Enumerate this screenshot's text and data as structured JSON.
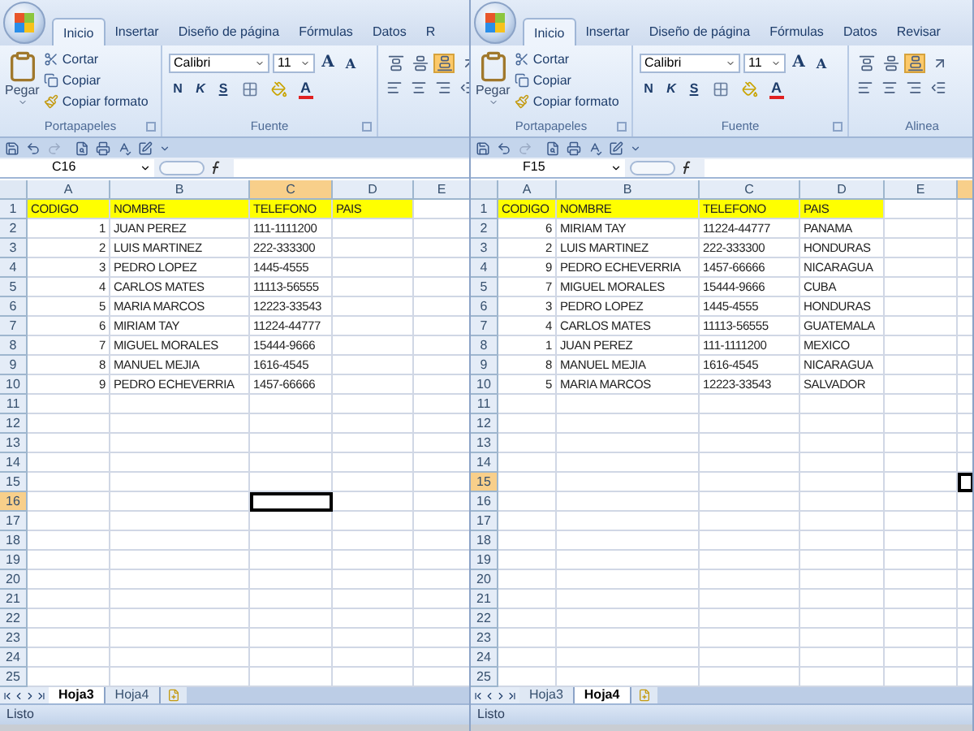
{
  "windows": [
    {
      "tabs": [
        {
          "label": "Inicio",
          "selected": true
        },
        {
          "label": "Insertar",
          "selected": false
        },
        {
          "label": "Diseño de página",
          "selected": false
        },
        {
          "label": "Fórmulas",
          "selected": false
        },
        {
          "label": "Datos",
          "selected": false
        },
        {
          "label": "R",
          "selected": false
        }
      ],
      "clipboard": {
        "paste": "Pegar",
        "items": [
          {
            "kind": "cut",
            "label": "Cortar"
          },
          {
            "kind": "copy",
            "label": "Copiar"
          },
          {
            "kind": "format",
            "label": "Copiar formato"
          }
        ],
        "label": "Portapapeles"
      },
      "font": {
        "name": "Calibri",
        "size": "11",
        "size_buttons": [
          "A",
          "A"
        ],
        "style_buttons": [
          "N",
          "K",
          "S"
        ],
        "color_button": "A",
        "label": "Fuente"
      },
      "alignment": {
        "buttons": [
          {
            "kind": "top",
            "selected": false
          },
          {
            "kind": "middle",
            "selected": false
          },
          {
            "kind": "bottom",
            "selected": true
          },
          {
            "kind": "orientation",
            "selected": false
          }
        ]
      },
      "name_box": "C16",
      "columns": [
        {
          "label": "A",
          "selected": false
        },
        {
          "label": "B",
          "selected": false
        },
        {
          "label": "C",
          "selected": true
        },
        {
          "label": "D",
          "selected": false
        },
        {
          "label": "E",
          "selected": false
        }
      ],
      "rows": [
        {
          "number": "1",
          "selected": false,
          "highlighted": true,
          "a": "CODIGO",
          "b": "NOMBRE",
          "c": "TELEFONO",
          "d": "PAIS"
        },
        {
          "number": "2",
          "selected": false,
          "highlighted": false,
          "a": "1",
          "b": "JUAN PEREZ",
          "c": "111-1111200"
        },
        {
          "number": "3",
          "selected": false,
          "highlighted": false,
          "a": "2",
          "b": "LUIS MARTINEZ",
          "c": "222-333300"
        },
        {
          "number": "4",
          "selected": false,
          "highlighted": false,
          "a": "3",
          "b": "PEDRO LOPEZ",
          "c": "1445-4555"
        },
        {
          "number": "5",
          "selected": false,
          "highlighted": false,
          "a": "4",
          "b": "CARLOS MATES",
          "c": "11113-56555"
        },
        {
          "number": "6",
          "selected": false,
          "highlighted": false,
          "a": "5",
          "b": "MARIA MARCOS",
          "c": "12223-33543"
        },
        {
          "number": "7",
          "selected": false,
          "highlighted": false,
          "a": "6",
          "b": "MIRIAM TAY",
          "c": "11224-44777"
        },
        {
          "number": "8",
          "selected": false,
          "highlighted": false,
          "a": "7",
          "b": "MIGUEL MORALES",
          "c": "15444-9666"
        },
        {
          "number": "9",
          "selected": false,
          "highlighted": false,
          "a": "8",
          "b": "MANUEL MEJIA",
          "c": "1616-4545"
        },
        {
          "number": "10",
          "selected": false,
          "highlighted": false,
          "a": "9",
          "b": "PEDRO ECHEVERRIA",
          "c": "1457-66666"
        },
        {
          "number": "11",
          "selected": false,
          "highlighted": false
        },
        {
          "number": "12",
          "selected": false,
          "highlighted": false
        },
        {
          "number": "13",
          "selected": false,
          "highlighted": false
        },
        {
          "number": "14",
          "selected": false,
          "highlighted": false
        },
        {
          "number": "15",
          "selected": false,
          "highlighted": false
        },
        {
          "number": "16",
          "selected": true,
          "highlighted": false
        },
        {
          "number": "17",
          "selected": false,
          "highlighted": false
        },
        {
          "number": "18",
          "selected": false,
          "highlighted": false
        },
        {
          "number": "19",
          "selected": false,
          "highlighted": false
        },
        {
          "number": "20",
          "selected": false,
          "highlighted": false
        },
        {
          "number": "21",
          "selected": false,
          "highlighted": false
        },
        {
          "number": "22",
          "selected": false,
          "highlighted": false
        },
        {
          "number": "23",
          "selected": false,
          "highlighted": false
        },
        {
          "number": "24",
          "selected": false,
          "highlighted": false
        },
        {
          "number": "25",
          "selected": false,
          "highlighted": false
        }
      ],
      "sheet_tabs": [
        {
          "label": "Hoja3",
          "selected": true
        },
        {
          "label": "Hoja4",
          "selected": false
        }
      ],
      "status": "Listo"
    },
    {
      "tabs": [
        {
          "label": "Inicio",
          "selected": true
        },
        {
          "label": "Insertar",
          "selected": false
        },
        {
          "label": "Diseño de página",
          "selected": false
        },
        {
          "label": "Fórmulas",
          "selected": false
        },
        {
          "label": "Datos",
          "selected": false
        },
        {
          "label": "Revisar",
          "selected": false
        }
      ],
      "clipboard": {
        "paste": "Pegar",
        "items": [
          {
            "kind": "cut",
            "label": "Cortar"
          },
          {
            "kind": "copy",
            "label": "Copiar"
          },
          {
            "kind": "format",
            "label": "Copiar formato"
          }
        ],
        "label": "Portapapeles"
      },
      "font": {
        "name": "Calibri",
        "size": "11",
        "size_buttons": [
          "A",
          "A"
        ],
        "style_buttons": [
          "N",
          "K",
          "S"
        ],
        "color_button": "A",
        "label": "Fuente"
      },
      "alignment": {
        "buttons": [
          {
            "kind": "top",
            "selected": false
          },
          {
            "kind": "middle",
            "selected": false
          },
          {
            "kind": "bottom",
            "selected": true
          },
          {
            "kind": "orientation",
            "selected": false
          }
        ],
        "label": "Alinea"
      },
      "name_box": "F15",
      "columns": [
        {
          "label": "A",
          "selected": false
        },
        {
          "label": "B",
          "selected": false
        },
        {
          "label": "C",
          "selected": false
        },
        {
          "label": "D",
          "selected": false
        },
        {
          "label": "E",
          "selected": false
        },
        {
          "selected": true
        }
      ],
      "rows": [
        {
          "number": "1",
          "selected": false,
          "highlighted": true,
          "a": "CODIGO",
          "b": "NOMBRE",
          "c": "TELEFONO",
          "d": "PAIS"
        },
        {
          "number": "2",
          "selected": false,
          "highlighted": false,
          "a": "6",
          "b": "MIRIAM TAY",
          "c": "11224-44777",
          "d": "PANAMA"
        },
        {
          "number": "3",
          "selected": false,
          "highlighted": false,
          "a": "2",
          "b": "LUIS MARTINEZ",
          "c": "222-333300",
          "d": "HONDURAS"
        },
        {
          "number": "4",
          "selected": false,
          "highlighted": false,
          "a": "9",
          "b": "PEDRO ECHEVERRIA",
          "c": "1457-66666",
          "d": "NICARAGUA"
        },
        {
          "number": "5",
          "selected": false,
          "highlighted": false,
          "a": "7",
          "b": "MIGUEL MORALES",
          "c": "15444-9666",
          "d": "CUBA"
        },
        {
          "number": "6",
          "selected": false,
          "highlighted": false,
          "a": "3",
          "b": "PEDRO LOPEZ",
          "c": "1445-4555",
          "d": "HONDURAS"
        },
        {
          "number": "7",
          "selected": false,
          "highlighted": false,
          "a": "4",
          "b": "CARLOS MATES",
          "c": "11113-56555",
          "d": "GUATEMALA"
        },
        {
          "number": "8",
          "selected": false,
          "highlighted": false,
          "a": "1",
          "b": "JUAN PEREZ",
          "c": "111-1111200",
          "d": "MEXICO"
        },
        {
          "number": "9",
          "selected": false,
          "highlighted": false,
          "a": "8",
          "b": "MANUEL MEJIA",
          "c": "1616-4545",
          "d": "NICARAGUA"
        },
        {
          "number": "10",
          "selected": false,
          "highlighted": false,
          "a": "5",
          "b": "MARIA MARCOS",
          "c": "12223-33543",
          "d": "SALVADOR"
        },
        {
          "number": "11",
          "selected": false,
          "highlighted": false
        },
        {
          "number": "12",
          "selected": false,
          "highlighted": false
        },
        {
          "number": "13",
          "selected": false,
          "highlighted": false
        },
        {
          "number": "14",
          "selected": false,
          "highlighted": false
        },
        {
          "number": "15",
          "selected": true,
          "highlighted": false
        },
        {
          "number": "16",
          "selected": false,
          "highlighted": false
        },
        {
          "number": "17",
          "selected": false,
          "highlighted": false
        },
        {
          "number": "18",
          "selected": false,
          "highlighted": false
        },
        {
          "number": "19",
          "selected": false,
          "highlighted": false
        },
        {
          "number": "20",
          "selected": false,
          "highlighted": false
        },
        {
          "number": "21",
          "selected": false,
          "highlighted": false
        },
        {
          "number": "22",
          "selected": false,
          "highlighted": false
        },
        {
          "number": "23",
          "selected": false,
          "highlighted": false
        },
        {
          "number": "24",
          "selected": false,
          "highlighted": false
        },
        {
          "number": "25",
          "selected": false,
          "highlighted": false
        }
      ],
      "sheet_tabs": [
        {
          "label": "Hoja3",
          "selected": false
        },
        {
          "label": "Hoja4",
          "selected": true
        }
      ],
      "status": "Listo"
    }
  ]
}
